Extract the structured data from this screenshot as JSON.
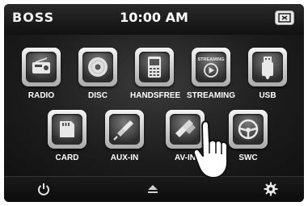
{
  "header": {
    "brand": "BOSS",
    "time": "10:00 AM",
    "screen_button_icon": "screen-toggle-icon"
  },
  "apps_row1": [
    {
      "label": "RADIO",
      "icon": "radio-icon"
    },
    {
      "label": "DISC",
      "icon": "disc-icon"
    },
    {
      "label": "HANDSFREE",
      "icon": "phone-icon"
    },
    {
      "label": "STREAMING",
      "icon": "streaming-play-icon",
      "icon_text": "STREAMING"
    },
    {
      "label": "USB",
      "icon": "usb-icon"
    }
  ],
  "apps_row2": [
    {
      "label": "CARD",
      "icon": "sd-card-icon"
    },
    {
      "label": "AUX-IN",
      "icon": "aux-plug-icon"
    },
    {
      "label": "AV-IN",
      "icon": "av-plug-icon"
    },
    {
      "label": "SWC",
      "icon": "steering-wheel-icon"
    }
  ],
  "bottom": {
    "power_icon": "power-icon",
    "eject_icon": "eject-icon",
    "settings_icon": "gear-icon"
  },
  "colors": {
    "screen_bg": "#1a1a1a",
    "tile": "#cfcfcf",
    "text": "#ffffff"
  }
}
